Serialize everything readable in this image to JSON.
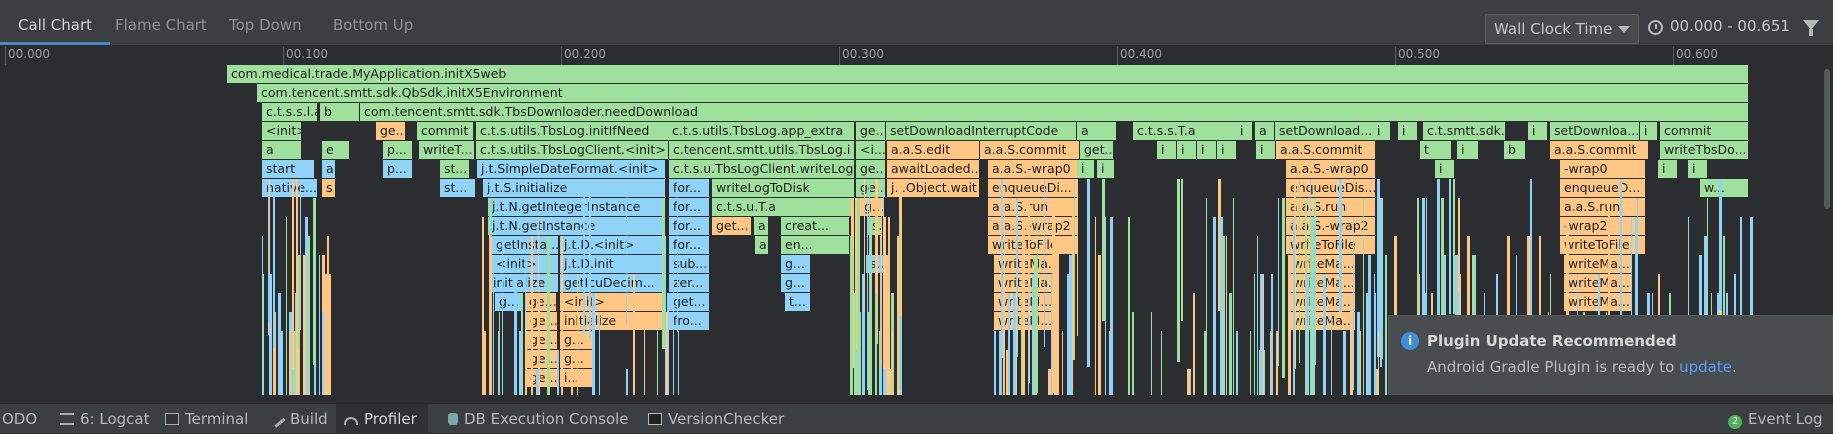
{
  "tabs": [
    "Call Chart",
    "Flame Chart",
    "Top Down",
    "Bottom Up"
  ],
  "active_tab": "Call Chart",
  "clock": {
    "selected": "Wall Clock Time",
    "range": "00.000 - 00.651"
  },
  "ruler": [
    "00.000",
    "00.100",
    "00.200",
    "00.300",
    "00.400",
    "00.500",
    "00.600"
  ],
  "flame": {
    "rows": [
      [
        [
          "com.medical.trade.MyApplication.initX5web",
          "g"
        ]
      ],
      [
        [
          "com.tencent.smtt.sdk.QbSdk.initX5Environment",
          "g"
        ]
      ],
      [
        [
          "c.t.s.s.l.a",
          "g"
        ],
        [
          "b",
          "g"
        ],
        [
          "com.tencent.smtt.sdk.TbsDownloader.needDownload",
          "g"
        ]
      ],
      [
        [
          "<init>",
          "g"
        ],
        [
          "ge...",
          "o"
        ],
        [
          "commit",
          "g"
        ],
        [
          "c.t.s.utils.TbsLog.initIfNeed",
          "g"
        ],
        [
          "c.t.s.utils.TbsLog.app_extra",
          "g"
        ],
        [
          "ge...",
          "g"
        ],
        [
          "setDownloadInterruptCode",
          "g"
        ],
        [
          "a",
          "g"
        ],
        [
          "c.t.s.s.T.a",
          "g"
        ],
        [
          "i",
          "g"
        ],
        [
          "a",
          "g"
        ],
        [
          "setDownload...",
          "g"
        ],
        [
          "i",
          "g"
        ],
        [
          "i",
          "g"
        ],
        [
          "c.t.smtt.sdk.l.m",
          "g"
        ],
        [
          "i",
          "g"
        ],
        [
          "setDownloa...",
          "g"
        ],
        [
          "i",
          "g"
        ],
        [
          "commit",
          "g"
        ]
      ],
      [
        [
          "a",
          "g"
        ],
        [
          "e",
          "g"
        ],
        [
          "p...",
          "g"
        ],
        [
          "writeT...",
          "g"
        ],
        [
          "c.t.s.utils.TbsLogClient.<init>",
          "g"
        ],
        [
          "c.tencent.smtt.utils.TbsLog.i",
          "g"
        ],
        [
          "<i...",
          "g"
        ],
        [
          "a.a.S.edit",
          "o"
        ],
        [
          "a.a.S.commit",
          "o"
        ],
        [
          "get...",
          "g"
        ],
        [
          "i",
          "g"
        ],
        [
          "i",
          "g"
        ],
        [
          "i",
          "g"
        ],
        [
          "i",
          "g"
        ],
        [
          "i",
          "g"
        ],
        [
          "a.a.S.commit",
          "o"
        ],
        [
          "t",
          "g"
        ],
        [
          "i",
          "g"
        ],
        [
          "b",
          "g"
        ],
        [
          "a.a.S.commit",
          "o"
        ],
        [
          "writeTbsDo...",
          "g"
        ]
      ],
      [
        [
          "start",
          "b"
        ],
        [
          "a",
          "b"
        ],
        [
          "p...",
          "b"
        ],
        [
          "st...",
          "g"
        ],
        [
          "j.t.SimpleDateFormat.<init>",
          "b"
        ],
        [
          "c.t.s.u.TbsLogClient.writeLog",
          "g"
        ],
        [
          "ge...",
          "g"
        ],
        [
          "awaitLoaded...",
          "o"
        ],
        [
          "a.a.S.-wrap0",
          "o"
        ],
        [
          "i",
          "g"
        ],
        [
          "i",
          "g"
        ],
        [
          "a.a.S.-wrap0",
          "o"
        ],
        [
          "i",
          "g"
        ],
        [
          "-wrap0",
          "o"
        ],
        [
          "i",
          "g"
        ],
        [
          "i",
          "g"
        ]
      ],
      [
        [
          "native...",
          "b"
        ],
        [
          "s",
          "o"
        ],
        [
          "st...",
          "b"
        ],
        [
          "j.t.S.initialize",
          "b"
        ],
        [
          "for...",
          "b"
        ],
        [
          "writeLogToDisk",
          "g"
        ],
        [
          "ge...",
          "g"
        ],
        [
          "j.l.Object.wait",
          "o"
        ],
        [
          "enqueueDi...",
          "o"
        ],
        [
          "enqueueDis...",
          "o"
        ],
        [
          "enqueueD...",
          "o"
        ],
        [
          "w...",
          "g"
        ]
      ],
      [
        [
          "j.t.N.getIntegerInstance",
          "b"
        ],
        [
          "for...",
          "b"
        ],
        [
          "c.t.s.u.T.a",
          "g"
        ],
        [
          "g...",
          "o"
        ],
        [
          "a.a.S.run",
          "o"
        ],
        [
          "a.a.S.run",
          "o"
        ],
        [
          "a.a.S.run",
          "o"
        ]
      ],
      [
        [
          "j.t.N.getInstance",
          "b"
        ],
        [
          "for...",
          "b"
        ],
        [
          "get...",
          "o"
        ],
        [
          "a",
          "g"
        ],
        [
          "creat...",
          "g"
        ],
        [
          "s...",
          "g"
        ],
        [
          "a.a.S.-wrap2",
          "o"
        ],
        [
          "a.a.S.-wrap2",
          "o"
        ],
        [
          "-wrap2",
          "o"
        ]
      ],
      [
        [
          "getInsta...",
          "b"
        ],
        [
          "j.t.D.<init>",
          "b"
        ],
        [
          "for...",
          "b"
        ],
        [
          "a",
          "g"
        ],
        [
          "en...",
          "g"
        ],
        [
          "writeToFile",
          "o"
        ],
        [
          "writeToFile",
          "o"
        ],
        [
          "writeToFile",
          "o"
        ]
      ],
      [
        [
          "<init>",
          "b"
        ],
        [
          "j.t.D.init",
          "b"
        ],
        [
          "sub...",
          "b"
        ],
        [
          "g...",
          "b"
        ],
        [
          "s...",
          "b"
        ],
        [
          "writeMa...",
          "o"
        ],
        [
          "writeMa...",
          "o"
        ],
        [
          "writeMa...",
          "o"
        ]
      ],
      [
        [
          "initialize",
          "b"
        ],
        [
          "getIcuDecim...",
          "b"
        ],
        [
          "zer...",
          "b"
        ],
        [
          "g...",
          "b"
        ],
        [
          "writeMa...",
          "o"
        ],
        [
          "writeMa...",
          "o"
        ],
        [
          "writeMa...",
          "o"
        ]
      ],
      [
        [
          "g...",
          "b"
        ],
        [
          "ge...",
          "o"
        ],
        [
          "<init>",
          "o"
        ],
        [
          "get...",
          "b"
        ],
        [
          "t...",
          "b"
        ],
        [
          "writeM...",
          "o"
        ],
        [
          "writeMa...",
          "o"
        ],
        [
          "writeMa...",
          "o"
        ]
      ],
      [
        [
          "ge...",
          "o"
        ],
        [
          "initialize",
          "o"
        ],
        [
          "fro...",
          "b"
        ],
        [
          "writeM...",
          "o"
        ],
        [
          "writeMa...",
          "o"
        ]
      ],
      [
        [
          "ge...",
          "o"
        ],
        [
          "g...",
          "o"
        ]
      ],
      [
        [
          "ge...",
          "o"
        ],
        [
          "g...",
          "o"
        ]
      ],
      [
        [
          "ge...",
          "o"
        ],
        [
          "i...",
          "o"
        ]
      ]
    ]
  },
  "notification": {
    "icon": "i",
    "title": "Plugin Update Recommended",
    "body": "Android Gradle Plugin is ready to ",
    "link": "update",
    "tail": "."
  },
  "bottom": {
    "todo": "ODO",
    "logcat": "6: Logcat",
    "terminal": "Terminal",
    "build": "Build",
    "profiler": "Profiler",
    "db": "DB Execution Console",
    "vc": "VersionChecker",
    "event_count": "2",
    "event": "Event Log"
  }
}
